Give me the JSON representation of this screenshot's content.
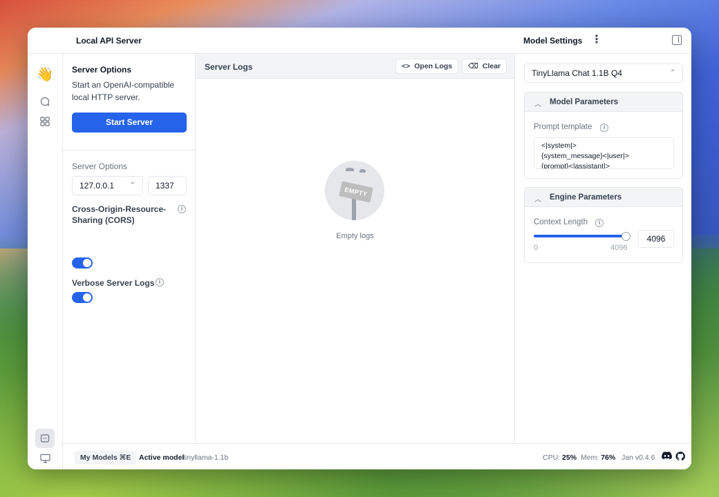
{
  "app": {
    "title": "Local API Server"
  },
  "model_settings_header": {
    "title": "Model Settings",
    "more_icon": "more-vertical-icon",
    "panel_icon": "panel-right-icon"
  },
  "nav": {
    "items": [
      {
        "name": "hello-hand-icon",
        "glyph": "👋"
      },
      {
        "name": "chat-icon",
        "glyph": "◯"
      },
      {
        "name": "grid-icon",
        "glyph": "▦"
      }
    ],
    "bottom": [
      {
        "name": "api-server-icon",
        "glyph": "▭"
      },
      {
        "name": "monitor-icon",
        "glyph": "🖵"
      },
      {
        "name": "settings-icon",
        "glyph": "⚙"
      }
    ]
  },
  "server_options": {
    "title": "Server Options",
    "description": "Start an OpenAI-compatible local HTTP server.",
    "start_button": "Start Server",
    "section_label": "Server Options",
    "host": "127.0.0.1",
    "port": "1337",
    "cors_label": "Cross-Origin-Resource-Sharing (CORS)",
    "cors_enabled": true,
    "verbose_label": "Verbose Server Logs",
    "verbose_enabled": true
  },
  "logs": {
    "title": "Server Logs",
    "open_logs": "Open Logs",
    "clear": "Clear",
    "empty_sign": "EMPTY",
    "empty_text": "Empty logs"
  },
  "settings": {
    "model": "TinyLlama Chat 1.1B Q4",
    "model_params_title": "Model Parameters",
    "prompt_template_label": "Prompt template",
    "prompt_template_value": "<|system|>\n{system_message}<|user|>\n{prompt}<|assistant|>",
    "engine_params_title": "Engine Parameters",
    "context_length_label": "Context Length",
    "context_min": "0",
    "context_max": "4096",
    "context_value": "4096",
    "context_fraction": 1.0
  },
  "status": {
    "my_models": "My Models ⌘E",
    "active_label": "Active model",
    "active_value": "tinyllama-1.1b",
    "cpu_label": "CPU:",
    "cpu_value": "25%",
    "mem_label": "Mem:",
    "mem_value": "76%",
    "version": "Jan v0.4.6"
  },
  "colors": {
    "accent": "#2563eb"
  }
}
